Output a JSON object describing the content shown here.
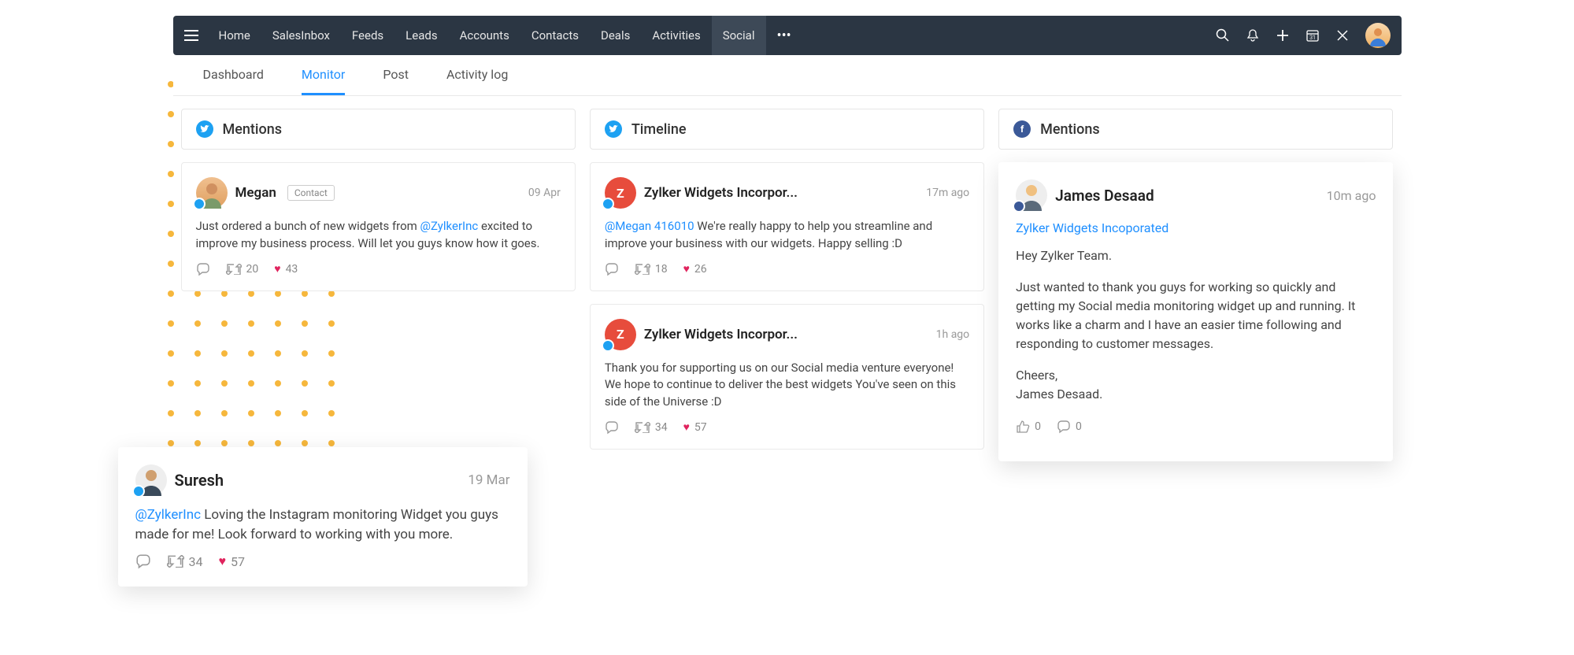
{
  "topnav": {
    "items": [
      "Home",
      "SalesInbox",
      "Feeds",
      "Leads",
      "Accounts",
      "Contacts",
      "Deals",
      "Activities",
      "Social"
    ],
    "active": "Social"
  },
  "subtabs": {
    "items": [
      "Dashboard",
      "Monitor",
      "Post",
      "Activity log"
    ],
    "active": "Monitor"
  },
  "columns": [
    {
      "icon": "twitter",
      "title": "Mentions",
      "cards": [
        {
          "avatar": "person",
          "name": "Megan",
          "tag": "Contact",
          "time": "09 Apr",
          "body_pre": "Just ordered a bunch of new widgets from ",
          "body_mention": "@ZylkerInc",
          "body_post": " excited to improve my business process. Will let you guys know how it goes.",
          "retweets": "20",
          "likes": "43"
        }
      ]
    },
    {
      "icon": "twitter",
      "title": "Timeline",
      "cards": [
        {
          "avatar": "Z",
          "name": "Zylker Widgets Incorpor...",
          "time": "17m ago",
          "body_mention": "@Megan 416010",
          "body_post": "  We're really happy to help you streamline and improve your business with our widgets. Happy selling :D",
          "retweets": "18",
          "likes": "26"
        },
        {
          "avatar": "Z",
          "name": "Zylker Widgets Incorpor...",
          "time": "1h ago",
          "body_post": "Thank you for supporting us on our Social media venture everyone! We hope to continue to deliver the best widgets You've seen on this side of the Universe :D",
          "retweets": "34",
          "likes": "57"
        }
      ]
    },
    {
      "icon": "facebook",
      "title": "Mentions",
      "cards": [
        {
          "avatar": "person",
          "name": "James Desaad",
          "time": "10m ago",
          "link": "Zylker Widgets Incoporated",
          "body_lines": [
            "Hey Zylker Team.",
            "Just wanted to thank you guys for working so quickly and getting my Social media monitoring widget up and running. It works like a charm and I have an easier  time following and responding to customer messages.",
            "Cheers,",
            "James Desaad."
          ],
          "thumbs": "0",
          "comments": "0"
        }
      ]
    }
  ],
  "floating": {
    "name": "Suresh",
    "time": "19 Mar",
    "body_mention": "@ZylkerInc",
    "body_post": " Loving the Instagram monitoring Widget you guys made for me! Look forward to working with you more.",
    "retweets": "34",
    "likes": "57"
  }
}
